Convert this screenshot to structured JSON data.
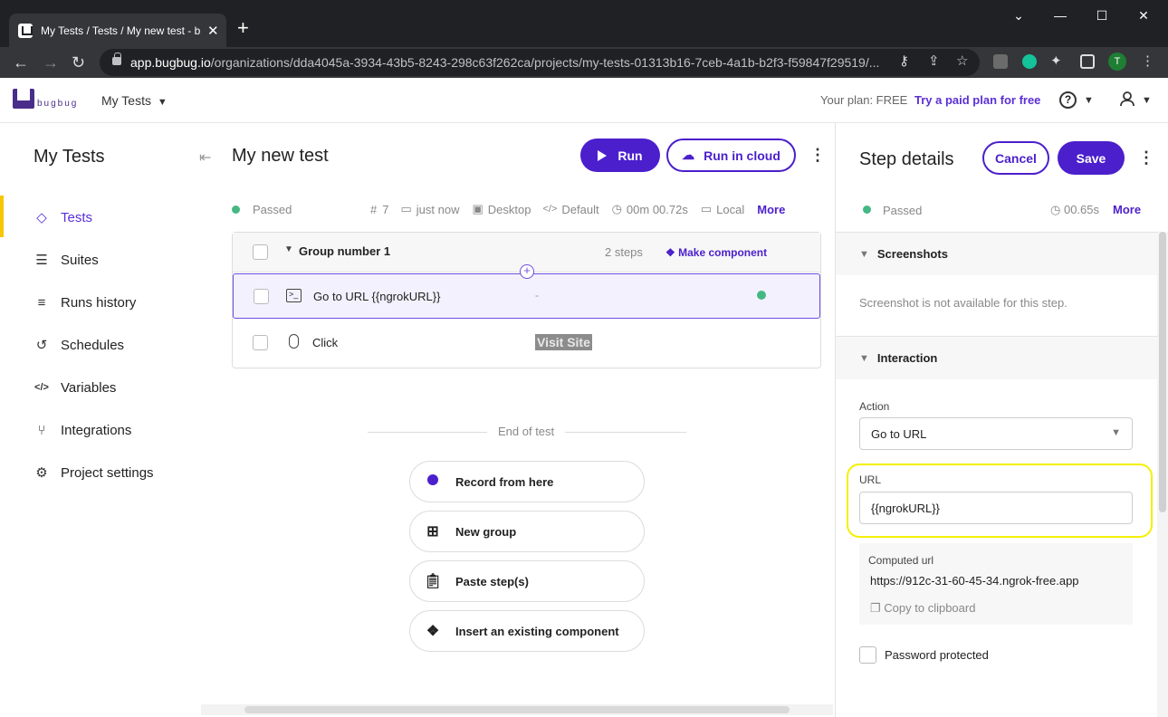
{
  "browser": {
    "tab_title": "My Tests / Tests / My new test - b",
    "url_host": "app.bugbug.io",
    "url_path": "/organizations/dda4045a-3934-43b5-8243-298c63f262ca/projects/my-tests-01313b16-7ceb-4a1b-b2f3-f59847f29519/...",
    "profile_initial": "T"
  },
  "header": {
    "logo_text": "bugbug",
    "project": "My Tests",
    "plan_label": "Your plan: FREE",
    "plan_link": "Try a paid plan for free"
  },
  "sidebar": {
    "title": "My Tests",
    "items": [
      {
        "label": "Tests",
        "icon": "diamond-icon"
      },
      {
        "label": "Suites",
        "icon": "layers-icon"
      },
      {
        "label": "Runs history",
        "icon": "list-check-icon"
      },
      {
        "label": "Schedules",
        "icon": "history-icon"
      },
      {
        "label": "Variables",
        "icon": "code-icon"
      },
      {
        "label": "Integrations",
        "icon": "git-branch-icon"
      },
      {
        "label": "Project settings",
        "icon": "gear-icon"
      }
    ]
  },
  "test": {
    "title": "My new test",
    "run_label": "Run",
    "run_cloud_label": "Run in cloud",
    "status": "Passed",
    "run_number": "7",
    "time": "just now",
    "device": "Desktop",
    "profile": "Default",
    "duration": "00m 00.72s",
    "location": "Local",
    "more": "More"
  },
  "steps": {
    "group_name": "Group number 1",
    "group_count": "2 steps",
    "make_component": "Make component",
    "rows": [
      {
        "label": "Go to URL {{ngrokURL}}",
        "value": "-"
      },
      {
        "label": "Click",
        "value": "Visit Site"
      }
    ]
  },
  "end": {
    "label": "End of test",
    "actions": [
      "Record from here",
      "New group",
      "Paste step(s)",
      "Insert an existing component"
    ]
  },
  "details": {
    "title": "Step details",
    "cancel": "Cancel",
    "save": "Save",
    "status": "Passed",
    "duration": "00.65s",
    "more": "More",
    "screenshots_label": "Screenshots",
    "screenshot_empty": "Screenshot is not available for this step.",
    "interaction_label": "Interaction",
    "action_label": "Action",
    "action_value": "Go to URL",
    "url_label": "URL",
    "url_value": "{{ngrokURL}}",
    "computed_label": "Computed url",
    "computed_value": "https://912c-31-60-45-34.ngrok-free.app",
    "copy_label": "Copy to clipboard",
    "password_label": "Password protected"
  },
  "colors": {
    "accent": "#4b1fcc",
    "success": "#43b883",
    "highlight": "#f4f000",
    "active_marker": "#f6c600"
  }
}
